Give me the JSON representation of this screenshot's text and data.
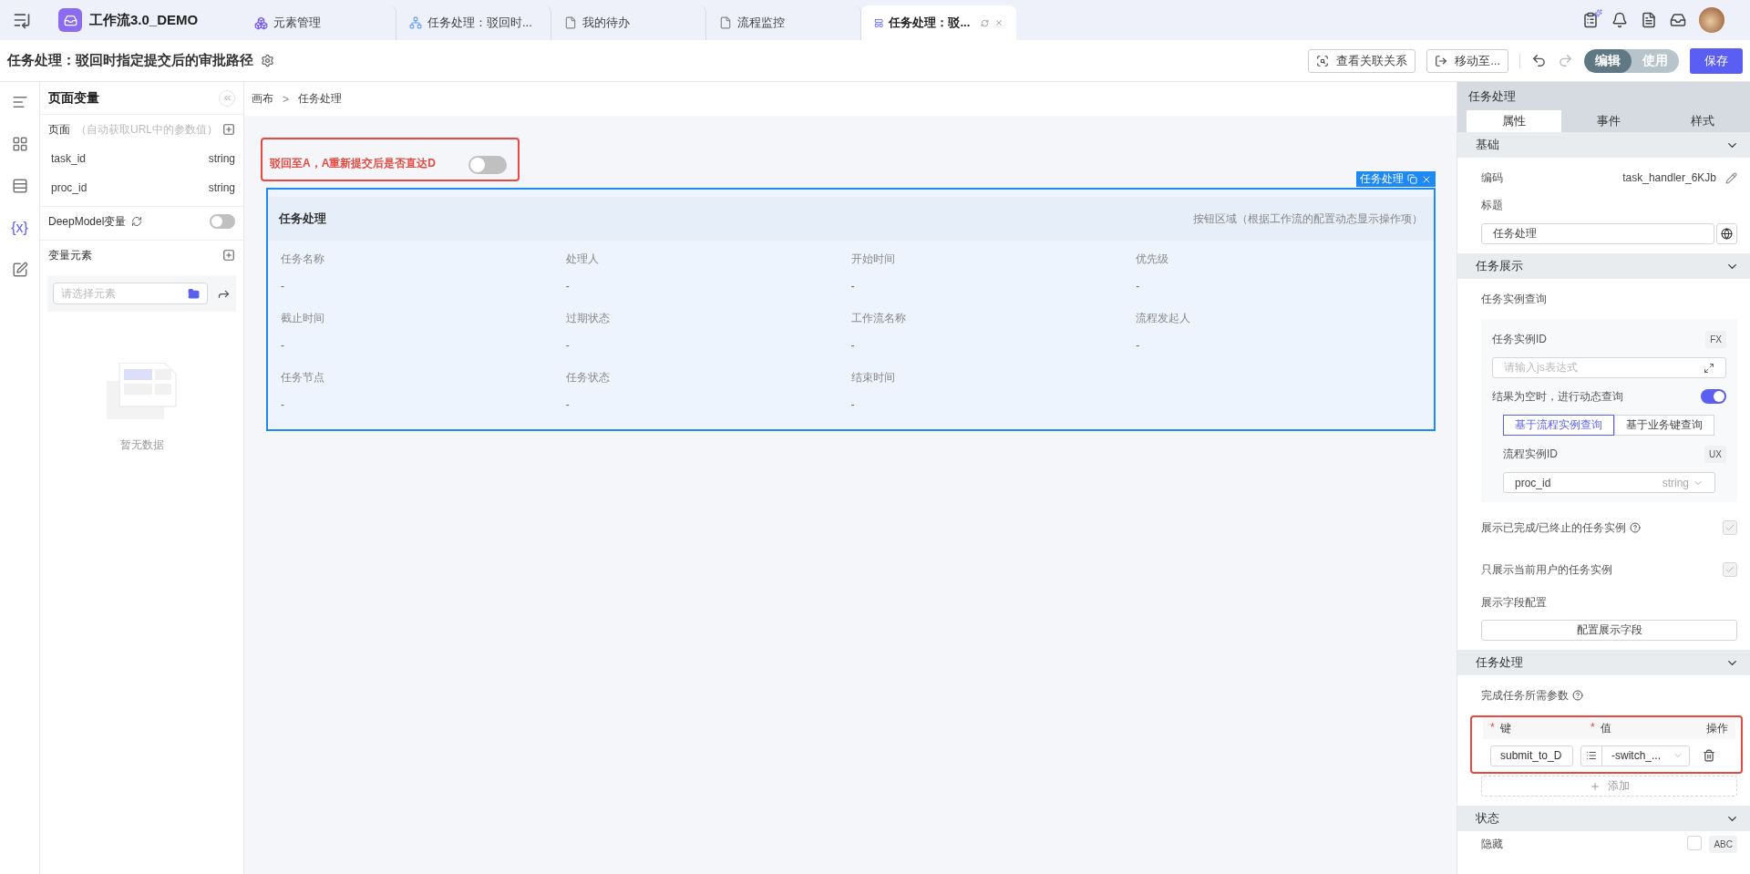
{
  "topbar": {
    "app_name": "工作流3.0_DEMO",
    "tabs": [
      {
        "label": "元素管理",
        "kind": "cube",
        "selected": false,
        "closable": false
      },
      {
        "label": "任务处理：驳回时...",
        "kind": "flow",
        "selected": false,
        "closable": false
      },
      {
        "label": "我的待办",
        "kind": "doc",
        "selected": false,
        "closable": false
      },
      {
        "label": "流程监控",
        "kind": "doc",
        "selected": false,
        "closable": false
      },
      {
        "label": "任务处理：驳...",
        "kind": "layout",
        "selected": true,
        "closable": true
      }
    ]
  },
  "titlebar": {
    "title": "任务处理：驳回时指定提交后的审批路径",
    "actions": [
      {
        "label": "查看关联关系",
        "kind": "relations"
      },
      {
        "label": "移动至...",
        "kind": "move"
      }
    ],
    "modes": [
      {
        "label": "编辑",
        "selected": true
      },
      {
        "label": "使用",
        "selected": false
      }
    ],
    "save": "保存"
  },
  "rail": [
    {
      "kind": "outline",
      "selected": false
    },
    {
      "kind": "grid",
      "selected": false
    },
    {
      "kind": "table",
      "selected": false
    },
    {
      "kind": "variables",
      "glyph": "{x}",
      "selected": true
    },
    {
      "kind": "edit",
      "selected": false
    }
  ],
  "variables": {
    "title": "页面变量",
    "page": {
      "label": "页面",
      "hint": "（自动获取URL中的参数值）",
      "params": [
        {
          "name": "task_id",
          "type": "string"
        },
        {
          "name": "proc_id",
          "type": "string"
        }
      ]
    },
    "deepmodel": {
      "label": "DeepModel变量",
      "on": false
    },
    "elements": {
      "label": "变量元素",
      "placeholder": "请选择元素",
      "empty": "暂无数据"
    }
  },
  "canvas": {
    "breadcrumb": {
      "items": [
        "画布",
        "任务处理"
      ],
      "separator": ">"
    },
    "switch": {
      "label": "驳回至A，A重新提交后是否直达D",
      "on": false
    },
    "card": {
      "tag": "任务处理",
      "title": "任务处理",
      "actions_hint": "按钮区域（根据工作流的配置动态显示操作项）",
      "fields": [
        {
          "label": "任务名称",
          "value": "-"
        },
        {
          "label": "处理人",
          "value": "-"
        },
        {
          "label": "开始时间",
          "value": "-"
        },
        {
          "label": "优先级",
          "value": "-"
        },
        {
          "label": "截止时间",
          "value": "-"
        },
        {
          "label": "过期状态",
          "value": "-"
        },
        {
          "label": "工作流名称",
          "value": "-"
        },
        {
          "label": "流程发起人",
          "value": "-"
        },
        {
          "label": "任务节点",
          "value": "-"
        },
        {
          "label": "任务状态",
          "value": "-"
        },
        {
          "label": "结束时间",
          "value": "-"
        }
      ]
    }
  },
  "inspector": {
    "title": "任务处理",
    "tabs": [
      {
        "label": "属性",
        "selected": true
      },
      {
        "label": "事件",
        "selected": false
      },
      {
        "label": "样式",
        "selected": false
      }
    ],
    "basic": {
      "title": "基础",
      "code_label": "编码",
      "code": "task_handler_6KJb",
      "title_label": "标题",
      "title_value": "任务处理"
    },
    "display": {
      "title": "任务展示",
      "query_label": "任务实例查询",
      "instance_label": "任务实例ID",
      "fx": "FX",
      "instance_placeholder": "请输入js表达式",
      "dynamic": {
        "label": "结果为空时，进行动态查询",
        "on": true
      },
      "modes": [
        {
          "label": "基于流程实例查询",
          "selected": true
        },
        {
          "label": "基于业务键查询",
          "selected": false
        }
      ],
      "proc_label": "流程实例ID",
      "ux": "UX",
      "proc_value": "proc_id",
      "proc_type": "string",
      "options": [
        {
          "label": "展示已完成/已终止的任务实例",
          "help": true,
          "checked": true
        },
        {
          "label": "只展示当前用户的任务实例",
          "help": false,
          "checked": true
        }
      ],
      "fields_label": "展示字段配置",
      "fields_button": "配置展示字段"
    },
    "handling": {
      "title": "任务处理",
      "params_label": "完成任务所需参数",
      "required_mark": "*",
      "columns": [
        {
          "label": "键",
          "required": true
        },
        {
          "label": "值",
          "required": true
        },
        {
          "label": "操作",
          "required": false
        }
      ],
      "rows": [
        {
          "key": "submit_to_D",
          "value": "-switch_..."
        }
      ],
      "add": "添加"
    },
    "state": {
      "title": "状态",
      "hidden_label": "隐藏",
      "hidden": false,
      "abc": "ABC"
    }
  }
}
